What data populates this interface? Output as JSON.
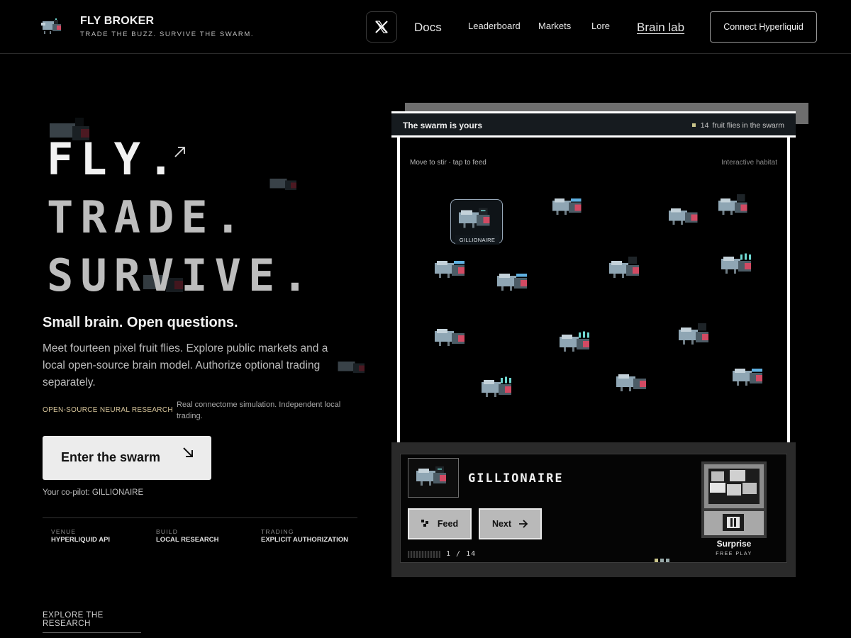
{
  "header": {
    "brand_title": "FLY BROKER",
    "brand_tagline": "TRADE THE BUZZ. SURVIVE THE SWARM.",
    "nav": {
      "docs": "Docs",
      "leaderboard": "Leaderboard",
      "markets": "Markets",
      "lore": "Lore",
      "brain_lab": "Brain lab"
    },
    "connect_label": "Connect Hyperliquid"
  },
  "hero": {
    "line1": "FLY.",
    "line2": "TRADE.",
    "line3": "SURVIVE.",
    "subheading": "Small brain. Open questions.",
    "intro": "Meet fourteen pixel fruit flies. Explore public markets and a local open-source brain model. Authorize optional trading separately.",
    "tag_label": "OPEN-SOURCE NEURAL RESEARCH",
    "tag_desc": "Real connectome simulation. Independent local trading.",
    "cta_label": "Enter the swarm",
    "copilot": "Your co-pilot: GILLIONAIRE",
    "meta": [
      {
        "key": "VENUE",
        "value": "HYPERLIQUID API"
      },
      {
        "key": "BUILD",
        "value": "LOCAL RESEARCH"
      },
      {
        "key": "TRADING",
        "value": "EXPLICIT AUTHORIZATION"
      }
    ],
    "explore_link": "EXPLORE THE RESEARCH"
  },
  "habitat": {
    "title": "The swarm is yours",
    "count": "14",
    "count_label": "fruit flies in the swarm",
    "hint": "Move to stir · tap to feed",
    "label": "Interactive habitat",
    "selected_name": "GILLIONAIRE"
  },
  "panel": {
    "name": "GILLIONAIRE",
    "feed_label": "Feed",
    "next_label": "Next",
    "pager": "1 / 14",
    "surprise_label": "Surprise",
    "surprise_sub": "FREE PLAY"
  },
  "colors": {
    "background": "#000000",
    "accent_tag": "#d6c49a",
    "fly_body": "#8fa6b4",
    "fly_eye": "#d24a63",
    "fly_crest": "#6fd6d0"
  },
  "icons": {
    "x": "x-logo-icon",
    "hero_arrow": "arrow-up-right-icon",
    "cta_arrow": "arrow-down-right-icon",
    "feed": "pixel-feed-icon",
    "next": "arrow-right-icon"
  }
}
